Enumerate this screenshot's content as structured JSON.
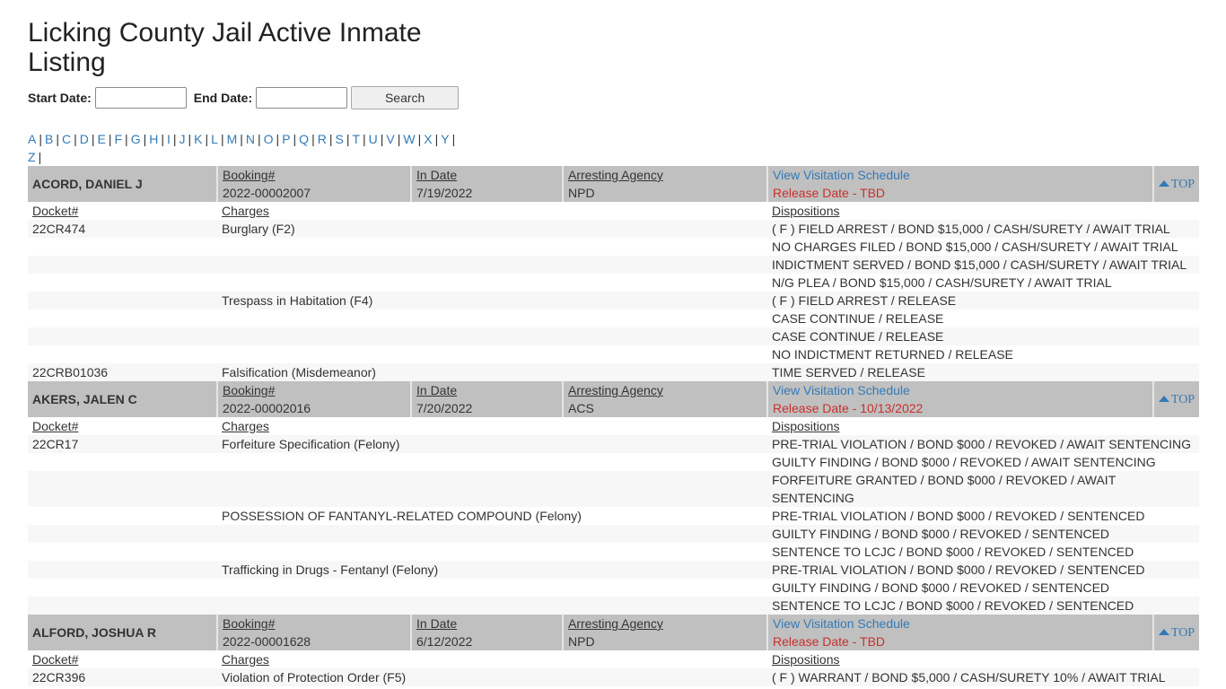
{
  "page": {
    "title": "Licking County Jail Active Inmate Listing"
  },
  "search": {
    "start_label": "Start Date:",
    "start_value": "",
    "end_label": "End Date:",
    "end_value": "",
    "button_label": "Search"
  },
  "alphabet": [
    "A",
    "B",
    "C",
    "D",
    "E",
    "F",
    "G",
    "H",
    "I",
    "J",
    "K",
    "L",
    "M",
    "N",
    "O",
    "P",
    "Q",
    "R",
    "S",
    "T",
    "U",
    "V",
    "W",
    "X",
    "Y",
    "Z"
  ],
  "alphabet_separator": "|",
  "labels": {
    "booking": "Booking#",
    "in_date": "In Date",
    "agency": "Arresting Agency",
    "visitation": "View Visitation Schedule",
    "top": "TOP",
    "docket": "Docket#",
    "charges": "Charges",
    "dispositions": "Dispositions"
  },
  "icons": {
    "top": "chevron-up-icon"
  },
  "colors": {
    "link": "#337ab7",
    "release": "#c9302c",
    "header_bg": "#c0c0c0",
    "stripe_bg": "#f7f7f7"
  },
  "inmates": [
    {
      "name": "ACORD, DANIEL J",
      "booking": "2022-00002007",
      "in_date": "7/19/2022",
      "agency": "NPD",
      "release": "Release Date - TBD",
      "rows": [
        {
          "docket": "22CR474",
          "charge": "Burglary (F2)",
          "disposition": "( F ) FIELD ARREST / BOND $15,000 / CASH/SURETY / AWAIT TRIAL"
        },
        {
          "docket": "",
          "charge": "",
          "disposition": "NO CHARGES FILED / BOND $15,000 / CASH/SURETY / AWAIT TRIAL"
        },
        {
          "docket": "",
          "charge": "",
          "disposition": "INDICTMENT SERVED / BOND $15,000 / CASH/SURETY / AWAIT TRIAL"
        },
        {
          "docket": "",
          "charge": "",
          "disposition": "N/G PLEA / BOND $15,000 / CASH/SURETY / AWAIT TRIAL"
        },
        {
          "docket": "",
          "charge": "Trespass in Habitation (F4)",
          "disposition": "( F ) FIELD ARREST / RELEASE"
        },
        {
          "docket": "",
          "charge": "",
          "disposition": "CASE CONTINUE / RELEASE"
        },
        {
          "docket": "",
          "charge": "",
          "disposition": "CASE CONTINUE / RELEASE"
        },
        {
          "docket": "",
          "charge": "",
          "disposition": "NO INDICTMENT RETURNED / RELEASE"
        },
        {
          "docket": "22CRB01036",
          "charge": "Falsification (Misdemeanor)",
          "disposition": "TIME SERVED / RELEASE"
        }
      ]
    },
    {
      "name": "AKERS, JALEN C",
      "booking": "2022-00002016",
      "in_date": "7/20/2022",
      "agency": "ACS",
      "release": "Release Date - 10/13/2022",
      "rows": [
        {
          "docket": "22CR17",
          "charge": "Forfeiture Specification (Felony)",
          "disposition": "PRE-TRIAL VIOLATION / BOND $000 / REVOKED / AWAIT SENTENCING"
        },
        {
          "docket": "",
          "charge": "",
          "disposition": "GUILTY FINDING / BOND $000 / REVOKED / AWAIT SENTENCING"
        },
        {
          "docket": "",
          "charge": "",
          "disposition": "FORFEITURE GRANTED / BOND $000 / REVOKED / AWAIT SENTENCING"
        },
        {
          "docket": "",
          "charge": "POSSESSION OF FANTANYL-RELATED COMPOUND (Felony)",
          "disposition": "PRE-TRIAL VIOLATION / BOND $000 / REVOKED / SENTENCED"
        },
        {
          "docket": "",
          "charge": "",
          "disposition": "GUILTY FINDING / BOND $000 / REVOKED / SENTENCED"
        },
        {
          "docket": "",
          "charge": "",
          "disposition": "SENTENCE TO LCJC / BOND $000 / REVOKED / SENTENCED"
        },
        {
          "docket": "",
          "charge": "Trafficking in Drugs - Fentanyl (Felony)",
          "disposition": "PRE-TRIAL VIOLATION / BOND $000 / REVOKED / SENTENCED"
        },
        {
          "docket": "",
          "charge": "",
          "disposition": "GUILTY FINDING / BOND $000 / REVOKED / SENTENCED"
        },
        {
          "docket": "",
          "charge": "",
          "disposition": "SENTENCE TO LCJC / BOND $000 / REVOKED / SENTENCED"
        }
      ]
    },
    {
      "name": "ALFORD, JOSHUA R",
      "booking": "2022-00001628",
      "in_date": "6/12/2022",
      "agency": "NPD",
      "release": "Release Date - TBD",
      "rows": [
        {
          "docket": "22CR396",
          "charge": "Violation of Protection Order (F5)",
          "disposition": "( F ) WARRANT / BOND $5,000 / CASH/SURETY 10% / AWAIT TRIAL"
        }
      ]
    }
  ]
}
